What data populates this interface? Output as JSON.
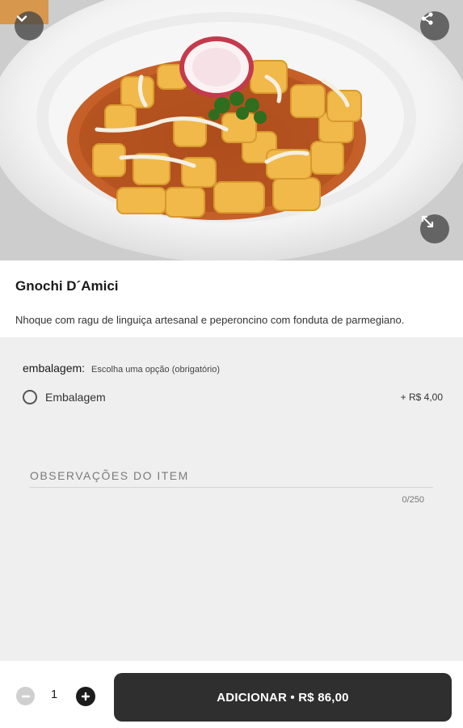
{
  "product": {
    "name": "Gnochi D´Amici",
    "description": "Nhoque com ragu de linguiça artesanal e peperoncino com fonduta de parmegiano."
  },
  "options_group": {
    "name": "embalagem:",
    "hint": "Escolha uma opção (obrigatório)",
    "items": [
      {
        "label": "Embalagem",
        "price": "+ R$ 4,00",
        "selected": false
      }
    ]
  },
  "notes": {
    "placeholder": "OBSERVAÇÕES DO ITEM",
    "counter": "0/250"
  },
  "footer": {
    "quantity": "1",
    "add_label": "ADICIONAR • R$ 86,00"
  },
  "icons": {
    "collapse": "chevron-down-icon",
    "share": "share-icon",
    "expand": "expand-icon",
    "minus": "minus-icon",
    "plus": "plus-icon"
  },
  "colors": {
    "add_button": "#2f2f2f",
    "page_background": "#efefef"
  }
}
